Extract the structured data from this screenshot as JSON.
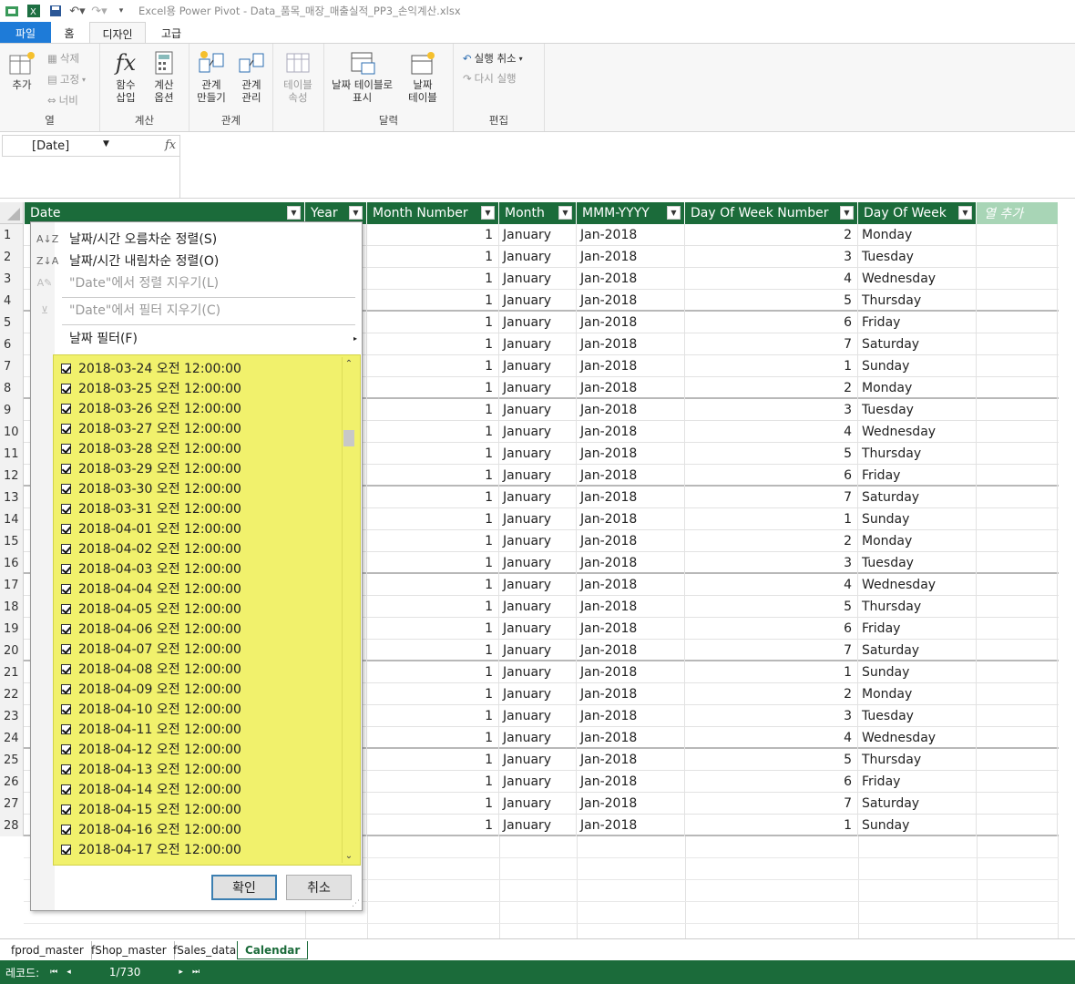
{
  "window": {
    "title": "Excel용 Power Pivot - Data_품목_매장_매출실적_PP3_손익계산.xlsx"
  },
  "tabs": {
    "file": "파일",
    "home": "홈",
    "design": "디자인",
    "advanced": "고급"
  },
  "ribbon": {
    "columns": {
      "add": "추가",
      "delete": "삭제",
      "freeze": "고정",
      "width": "너비",
      "label": "열"
    },
    "calc": {
      "insert_fn": "함수\n삽입",
      "calc_opts": "계산\n옵션",
      "label": "계산"
    },
    "rel": {
      "create": "관계\n만들기",
      "manage": "관계\n관리",
      "label": "관계"
    },
    "table": {
      "props": "테이블\n속성"
    },
    "calendar": {
      "show": "날짜 테이블로\n표시",
      "date_table": "날짜\n테이블",
      "label": "달력"
    },
    "edit": {
      "undo": "실행 취소",
      "redo": "다시 실행",
      "label": "편집"
    }
  },
  "formula_bar": {
    "name_box": "[Date]",
    "fx": "fx"
  },
  "columns": {
    "date": "Date",
    "year": "Year",
    "month_number": "Month Number",
    "month": "Month",
    "mmm_yyyy": "MMM-YYYY",
    "dow_number": "Day Of Week Number",
    "dow": "Day Of Week",
    "add": "열 추가"
  },
  "rows": [
    {
      "n": "1",
      "mn": "1",
      "m": "January",
      "my": "Jan-2018",
      "dn": "2",
      "d": "Monday"
    },
    {
      "n": "2",
      "mn": "1",
      "m": "January",
      "my": "Jan-2018",
      "dn": "3",
      "d": "Tuesday"
    },
    {
      "n": "3",
      "mn": "1",
      "m": "January",
      "my": "Jan-2018",
      "dn": "4",
      "d": "Wednesday"
    },
    {
      "n": "4",
      "mn": "1",
      "m": "January",
      "my": "Jan-2018",
      "dn": "5",
      "d": "Thursday"
    },
    {
      "n": "5",
      "mn": "1",
      "m": "January",
      "my": "Jan-2018",
      "dn": "6",
      "d": "Friday"
    },
    {
      "n": "6",
      "mn": "1",
      "m": "January",
      "my": "Jan-2018",
      "dn": "7",
      "d": "Saturday"
    },
    {
      "n": "7",
      "mn": "1",
      "m": "January",
      "my": "Jan-2018",
      "dn": "1",
      "d": "Sunday"
    },
    {
      "n": "8",
      "mn": "1",
      "m": "January",
      "my": "Jan-2018",
      "dn": "2",
      "d": "Monday"
    },
    {
      "n": "9",
      "mn": "1",
      "m": "January",
      "my": "Jan-2018",
      "dn": "3",
      "d": "Tuesday"
    },
    {
      "n": "10",
      "mn": "1",
      "m": "January",
      "my": "Jan-2018",
      "dn": "4",
      "d": "Wednesday"
    },
    {
      "n": "11",
      "mn": "1",
      "m": "January",
      "my": "Jan-2018",
      "dn": "5",
      "d": "Thursday"
    },
    {
      "n": "12",
      "mn": "1",
      "m": "January",
      "my": "Jan-2018",
      "dn": "6",
      "d": "Friday"
    },
    {
      "n": "13",
      "mn": "1",
      "m": "January",
      "my": "Jan-2018",
      "dn": "7",
      "d": "Saturday"
    },
    {
      "n": "14",
      "mn": "1",
      "m": "January",
      "my": "Jan-2018",
      "dn": "1",
      "d": "Sunday"
    },
    {
      "n": "15",
      "mn": "1",
      "m": "January",
      "my": "Jan-2018",
      "dn": "2",
      "d": "Monday"
    },
    {
      "n": "16",
      "mn": "1",
      "m": "January",
      "my": "Jan-2018",
      "dn": "3",
      "d": "Tuesday"
    },
    {
      "n": "17",
      "mn": "1",
      "m": "January",
      "my": "Jan-2018",
      "dn": "4",
      "d": "Wednesday"
    },
    {
      "n": "18",
      "mn": "1",
      "m": "January",
      "my": "Jan-2018",
      "dn": "5",
      "d": "Thursday"
    },
    {
      "n": "19",
      "mn": "1",
      "m": "January",
      "my": "Jan-2018",
      "dn": "6",
      "d": "Friday"
    },
    {
      "n": "20",
      "mn": "1",
      "m": "January",
      "my": "Jan-2018",
      "dn": "7",
      "d": "Saturday"
    },
    {
      "n": "21",
      "mn": "1",
      "m": "January",
      "my": "Jan-2018",
      "dn": "1",
      "d": "Sunday"
    },
    {
      "n": "22",
      "mn": "1",
      "m": "January",
      "my": "Jan-2018",
      "dn": "2",
      "d": "Monday"
    },
    {
      "n": "23",
      "mn": "1",
      "m": "January",
      "my": "Jan-2018",
      "dn": "3",
      "d": "Tuesday"
    },
    {
      "n": "24",
      "mn": "1",
      "m": "January",
      "my": "Jan-2018",
      "dn": "4",
      "d": "Wednesday"
    },
    {
      "n": "25",
      "mn": "1",
      "m": "January",
      "my": "Jan-2018",
      "dn": "5",
      "d": "Thursday"
    },
    {
      "n": "26",
      "mn": "1",
      "m": "January",
      "my": "Jan-2018",
      "dn": "6",
      "d": "Friday"
    },
    {
      "n": "27",
      "mn": "1",
      "m": "January",
      "my": "Jan-2018",
      "dn": "7",
      "d": "Saturday"
    },
    {
      "n": "28",
      "mn": "1",
      "m": "January",
      "my": "Jan-2018",
      "dn": "1",
      "d": "Sunday"
    }
  ],
  "popup": {
    "sort_asc": "날짜/시간 오름차순 정렬(S)",
    "sort_desc": "날짜/시간 내림차순 정렬(O)",
    "clear_sort": "\"Date\"에서 정렬 지우기(L)",
    "clear_filter": "\"Date\"에서 필터 지우기(C)",
    "date_filter": "날짜 필터(F)",
    "ok": "확인",
    "cancel": "취소",
    "items": [
      "2018-03-24 오전 12:00:00",
      "2018-03-25 오전 12:00:00",
      "2018-03-26 오전 12:00:00",
      "2018-03-27 오전 12:00:00",
      "2018-03-28 오전 12:00:00",
      "2018-03-29 오전 12:00:00",
      "2018-03-30 오전 12:00:00",
      "2018-03-31 오전 12:00:00",
      "2018-04-01 오전 12:00:00",
      "2018-04-02 오전 12:00:00",
      "2018-04-03 오전 12:00:00",
      "2018-04-04 오전 12:00:00",
      "2018-04-05 오전 12:00:00",
      "2018-04-06 오전 12:00:00",
      "2018-04-07 오전 12:00:00",
      "2018-04-08 오전 12:00:00",
      "2018-04-09 오전 12:00:00",
      "2018-04-10 오전 12:00:00",
      "2018-04-11 오전 12:00:00",
      "2018-04-12 오전 12:00:00",
      "2018-04-13 오전 12:00:00",
      "2018-04-14 오전 12:00:00",
      "2018-04-15 오전 12:00:00",
      "2018-04-16 오전 12:00:00",
      "2018-04-17 오전 12:00:00"
    ]
  },
  "sheets": [
    "fprod_master",
    "fShop_master",
    "fSales_data",
    "Calendar"
  ],
  "status": {
    "records_label": "레코드:",
    "position": "1/730"
  }
}
